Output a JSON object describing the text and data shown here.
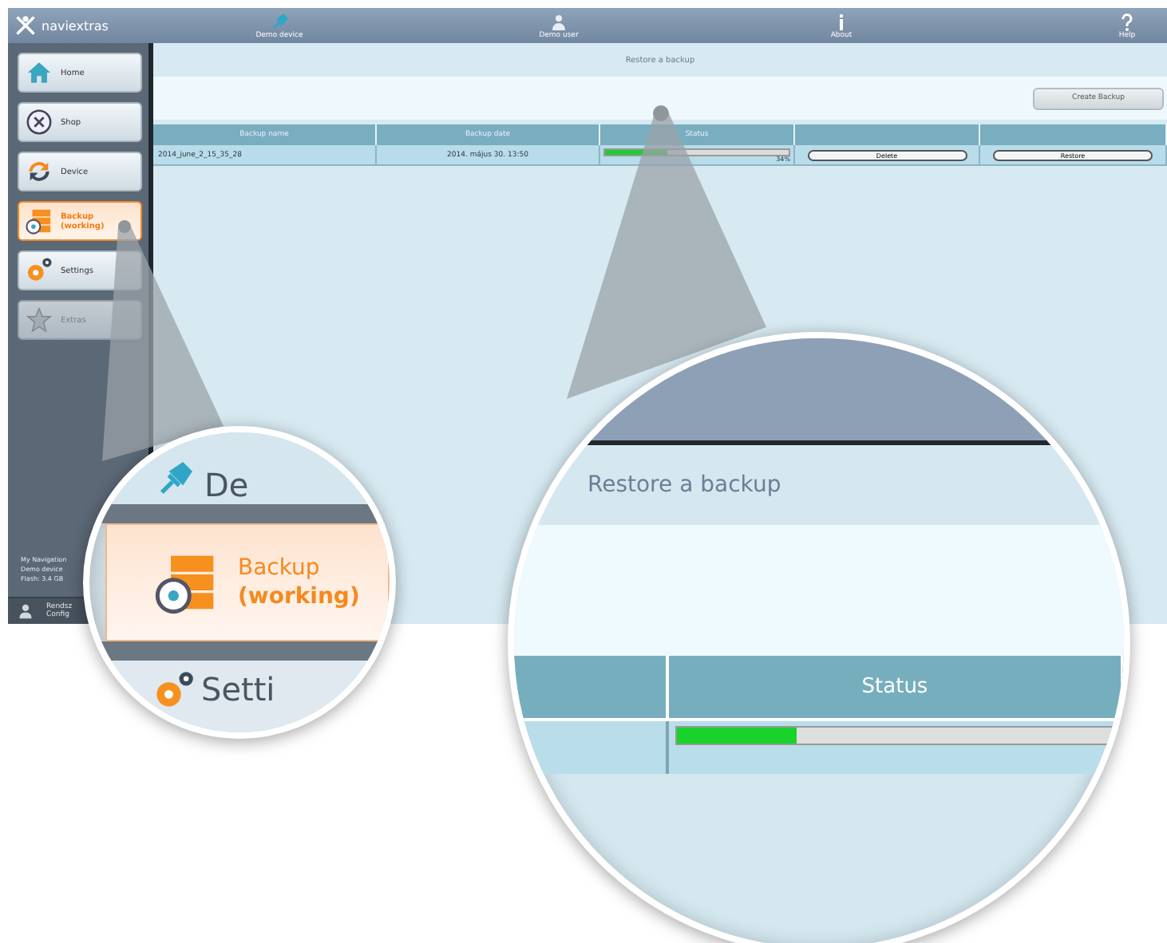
{
  "app": {
    "logo": "naviextras"
  },
  "toolbar": [
    {
      "kind": "device",
      "label": "Demo device"
    },
    {
      "kind": "user",
      "label": "Demo user"
    },
    {
      "kind": "about",
      "label": "About"
    },
    {
      "kind": "help",
      "label": "Help"
    }
  ],
  "sidebar": {
    "items": [
      {
        "kind": "home",
        "label": "Home",
        "selected": false,
        "disabled": false
      },
      {
        "kind": "shop",
        "label": "Shop",
        "selected": false,
        "disabled": false
      },
      {
        "kind": "device",
        "label": "Device",
        "selected": false,
        "disabled": false
      },
      {
        "kind": "backup",
        "label": "Backup",
        "status": "(working)",
        "selected": true,
        "disabled": false
      },
      {
        "kind": "settings",
        "label": "Settings",
        "selected": false,
        "disabled": false
      },
      {
        "kind": "extras",
        "label": "Extras",
        "selected": false,
        "disabled": true
      }
    ],
    "info": [
      "My Navigation",
      "Demo device",
      "Flash: 3.4 GB"
    ],
    "footer": [
      "Rendsz",
      "Config"
    ]
  },
  "page": {
    "title": "Restore a backup",
    "create_button": "Create Backup"
  },
  "table": {
    "columns": [
      "Backup name",
      "Backup date",
      "Status",
      "",
      ""
    ],
    "rows": [
      {
        "name": "2014_june_2_15_35_28",
        "date": "2014. május 30. 13:50",
        "level": 0.34,
        "reading": "34%",
        "delete": "Delete",
        "restore": "Restore"
      }
    ]
  },
  "magnifier_sidebar": {
    "partial_label": "De",
    "label": "Backup",
    "status": "(working)",
    "next_label": "Setti"
  },
  "magnifier_content": {
    "title": "Restore a backup",
    "column": "Status",
    "level": 0.27
  }
}
